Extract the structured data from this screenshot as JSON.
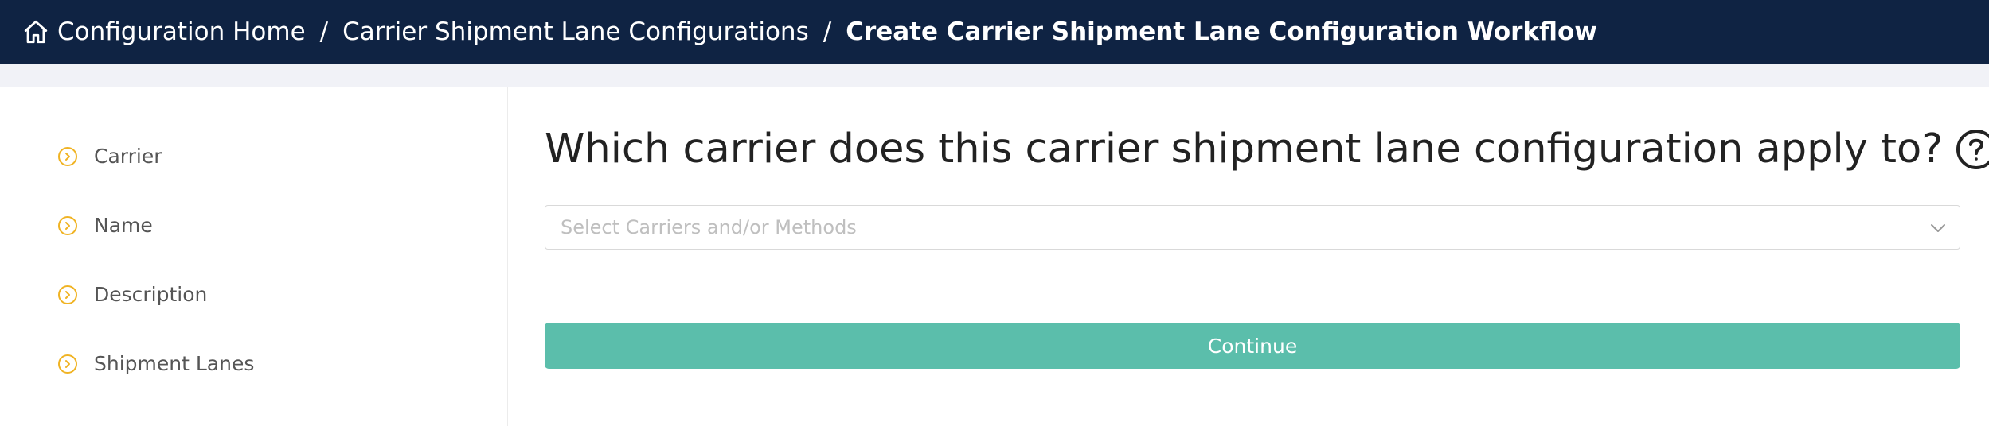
{
  "header": {
    "background": "#0f2343",
    "home_icon": "home-icon",
    "breadcrumbs": [
      {
        "label": "Configuration Home"
      },
      {
        "label": "Carrier Shipment Lane Configurations"
      },
      {
        "label": "Create Carrier Shipment Lane Configuration Workflow"
      }
    ],
    "separator": "/"
  },
  "sidebar": {
    "step_icon": "chevron-circle-right-icon",
    "step_icon_color": "#f0b323",
    "steps": [
      {
        "label": "Carrier"
      },
      {
        "label": "Name"
      },
      {
        "label": "Description"
      },
      {
        "label": "Shipment Lanes"
      }
    ]
  },
  "main": {
    "question": "Which carrier does this carrier shipment lane configuration apply to?",
    "help_icon": "question-circle-icon",
    "carrier_select": {
      "placeholder": "Select Carriers and/or Methods",
      "value": "",
      "icon": "chevron-down-icon"
    },
    "continue_label": "Continue",
    "accent_color": "#5bbeab"
  }
}
